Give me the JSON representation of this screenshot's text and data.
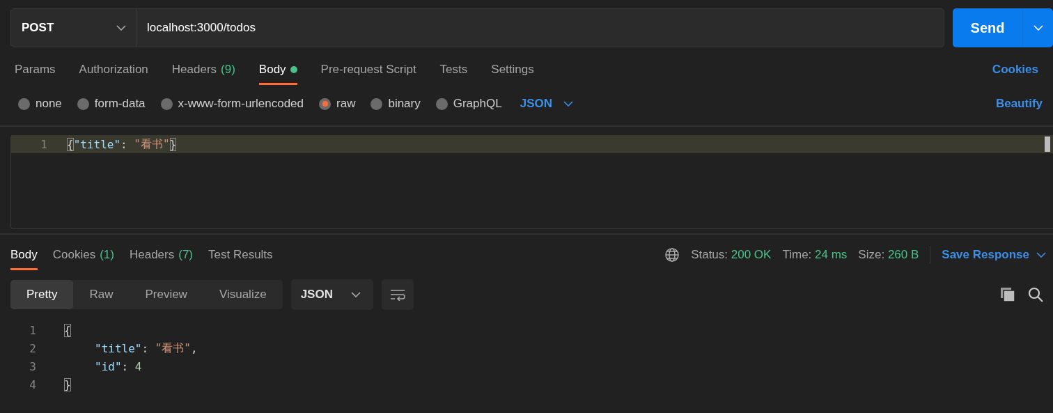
{
  "request": {
    "method": "POST",
    "url": "localhost:3000/todos",
    "send_label": "Send"
  },
  "request_tabs": [
    {
      "label": "Params",
      "selected": false
    },
    {
      "label": "Authorization",
      "selected": false
    },
    {
      "label": "Headers",
      "count": "(9)",
      "selected": false
    },
    {
      "label": "Body",
      "selected": true,
      "dot": true
    },
    {
      "label": "Pre-request Script",
      "selected": false
    },
    {
      "label": "Tests",
      "selected": false
    },
    {
      "label": "Settings",
      "selected": false
    }
  ],
  "cookies_link": "Cookies",
  "body_types": [
    {
      "label": "none",
      "selected": false
    },
    {
      "label": "form-data",
      "selected": false
    },
    {
      "label": "x-www-form-urlencoded",
      "selected": false
    },
    {
      "label": "raw",
      "selected": true
    },
    {
      "label": "binary",
      "selected": false
    },
    {
      "label": "GraphQL",
      "selected": false
    }
  ],
  "body_format": "JSON",
  "beautify": "Beautify",
  "request_editor": {
    "lines": [
      {
        "number": "1",
        "highlighted": true,
        "indent": false,
        "tokens": [
          {
            "kind": "brace",
            "text": "{"
          },
          {
            "kind": "key",
            "text": "\"title\""
          },
          {
            "kind": "punct",
            "text": ": "
          },
          {
            "kind": "string",
            "text": "\"看书\""
          },
          {
            "kind": "brace",
            "text": "}"
          }
        ]
      }
    ]
  },
  "response_tabs": [
    {
      "label": "Body",
      "selected": true
    },
    {
      "label": "Cookies",
      "count": "(1)",
      "selected": false
    },
    {
      "label": "Headers",
      "count": "(7)",
      "selected": false
    },
    {
      "label": "Test Results",
      "selected": false
    }
  ],
  "status": [
    {
      "label": "Status:",
      "value": "200 OK"
    },
    {
      "label": "Time:",
      "value": "24 ms"
    },
    {
      "label": "Size:",
      "value": "260 B"
    }
  ],
  "save_response": "Save Response",
  "view_modes": [
    {
      "label": "Pretty",
      "selected": true
    },
    {
      "label": "Raw",
      "selected": false
    },
    {
      "label": "Preview",
      "selected": false
    },
    {
      "label": "Visualize",
      "selected": false
    }
  ],
  "response_format": "JSON",
  "response_editor": {
    "lines": [
      {
        "number": "1",
        "highlighted": false,
        "indent": false,
        "tokens": [
          {
            "kind": "brace",
            "text": "{"
          }
        ]
      },
      {
        "number": "2",
        "highlighted": false,
        "indent": true,
        "tokens": [
          {
            "kind": "key",
            "text": "\"title\""
          },
          {
            "kind": "punct",
            "text": ": "
          },
          {
            "kind": "string",
            "text": "\"看书\""
          },
          {
            "kind": "punct",
            "text": ","
          }
        ]
      },
      {
        "number": "3",
        "highlighted": false,
        "indent": true,
        "tokens": [
          {
            "kind": "key",
            "text": "\"id\""
          },
          {
            "kind": "punct",
            "text": ": "
          },
          {
            "kind": "number",
            "text": "4"
          }
        ]
      },
      {
        "number": "4",
        "highlighted": false,
        "indent": false,
        "tokens": [
          {
            "kind": "brace",
            "text": "}"
          }
        ]
      }
    ]
  }
}
